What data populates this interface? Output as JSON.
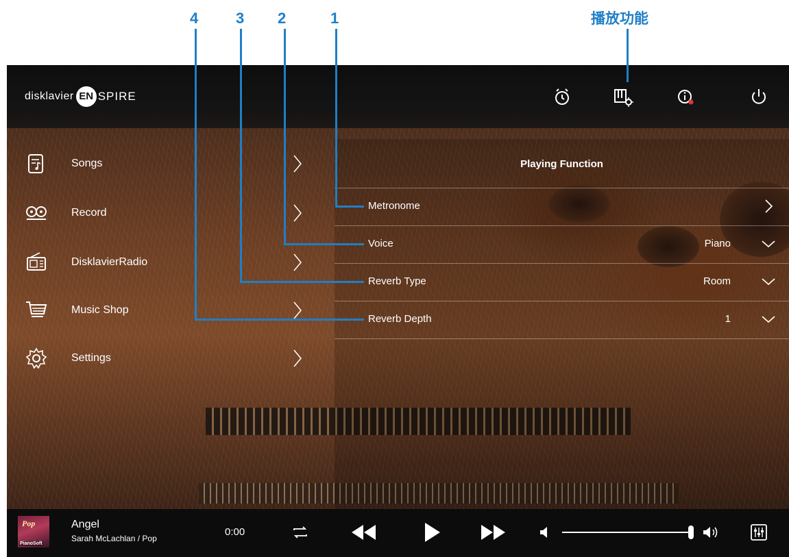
{
  "callouts": {
    "n1": "1",
    "n2": "2",
    "n3": "3",
    "n4": "4",
    "playing_function_cn": "播放功能"
  },
  "brand": {
    "prefix": "disklavier",
    "en": "EN",
    "rest": "SPIRE"
  },
  "topbar": {
    "icons": [
      "alarm-clock-icon",
      "playing-function-icon",
      "info-icon",
      "power-icon"
    ],
    "info_dot_color": "#e0343a"
  },
  "sidebar": {
    "items": [
      {
        "label": "Songs",
        "icon": "songs-icon"
      },
      {
        "label": "Record",
        "icon": "record-reel-icon"
      },
      {
        "label": "DisklavierRadio",
        "icon": "radio-icon"
      },
      {
        "label": "Music Shop",
        "icon": "shopping-cart-icon"
      },
      {
        "label": "Settings",
        "icon": "gear-icon"
      }
    ]
  },
  "panel": {
    "title": "Playing Function",
    "rows": [
      {
        "label": "Metronome",
        "value": "",
        "control": "chevron-right-icon"
      },
      {
        "label": "Voice",
        "value": "Piano",
        "control": "chevron-down-icon"
      },
      {
        "label": "Reverb Type",
        "value": "Room",
        "control": "chevron-down-icon"
      },
      {
        "label": "Reverb Depth",
        "value": "1",
        "control": "chevron-down-icon"
      }
    ]
  },
  "player": {
    "album_genre": "Pop",
    "album_brand": "PianoSoft",
    "title": "Angel",
    "subtitle": "Sarah McLachlan / Pop",
    "time": "0:00",
    "volume": 1.0
  },
  "colors": {
    "accent": "#1f7fc7",
    "text": "#ffffff",
    "topbar": "#111111",
    "player": "#0c0c0c"
  }
}
